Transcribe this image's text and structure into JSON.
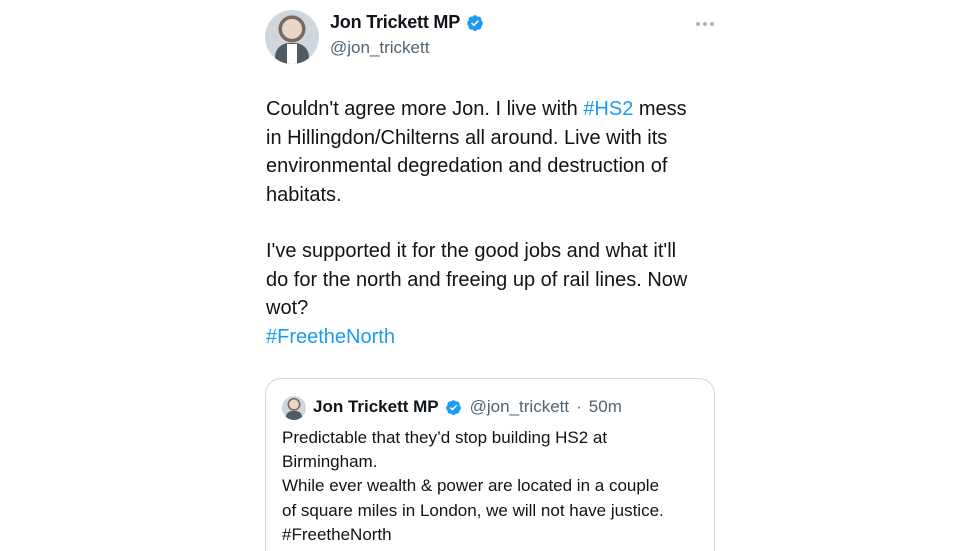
{
  "author": {
    "display_name": "Jon Trickett MP",
    "handle": "@jon_trickett"
  },
  "icons": {
    "verified": "verified-badge-icon",
    "more": "more-options-icon"
  },
  "colors": {
    "link": "#1d9bf0",
    "verified": "#1d9bf0",
    "secondary_text": "#536471",
    "border": "#cfd9de"
  },
  "tweet": {
    "para1": [
      {
        "text": "Couldn't agree more Jon. I live with ",
        "tag": ""
      },
      {
        "text": "#HS2",
        "tag": "hashtag"
      },
      {
        "text": " mess",
        "tag": ""
      }
    ],
    "lines": {
      "l2": "in Hillingdon/Chilterns all around. Live with its",
      "l3": "environmental degredation and destruction of",
      "l4": "habitats.",
      "l5": "I've supported it for the good jobs and what it'll",
      "l6": "do for the north and freeing up of rail lines.  Now",
      "l7": "wot?",
      "l8": "#FreetheNorth"
    }
  },
  "quote": {
    "display_name": "Jon Trickett MP",
    "handle": "@jon_trickett",
    "separator": "·",
    "time": "50m",
    "lines": {
      "l1": "Predictable that they’d stop building HS2 at",
      "l2": "Birmingham.",
      "l3": "While ever wealth & power are located in a couple",
      "l4": "of square miles in London, we will not have justice.",
      "l5": "#FreetheNorth"
    }
  }
}
